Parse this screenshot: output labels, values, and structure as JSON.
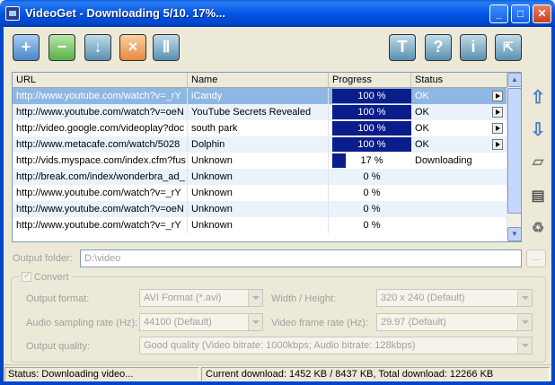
{
  "window": {
    "title": "VideoGet - Downloading 5/10. 17%..."
  },
  "toolbar": {
    "add": "+",
    "remove": "−",
    "download": "↓",
    "stop": "×",
    "pause": "Ⅱ",
    "t": "T",
    "help": "?",
    "info": "i"
  },
  "table": {
    "columns": [
      "URL",
      "Name",
      "Progress",
      "Status"
    ],
    "rows": [
      {
        "url": "http://www.youtube.com/watch?v=_rY",
        "name": "iCandy",
        "progress": 100,
        "progress_text": "100 %",
        "status": "OK"
      },
      {
        "url": "http://www.youtube.com/watch?v=oeN",
        "name": "YouTube Secrets Revealed",
        "progress": 100,
        "progress_text": "100 %",
        "status": "OK"
      },
      {
        "url": "http://video.google.com/videoplay?doc",
        "name": "south park",
        "progress": 100,
        "progress_text": "100 %",
        "status": "OK"
      },
      {
        "url": "http://www.metacafe.com/watch/5028",
        "name": "Dolphin",
        "progress": 100,
        "progress_text": "100 %",
        "status": "OK"
      },
      {
        "url": "http://vids.myspace.com/index.cfm?fus",
        "name": "Unknown",
        "progress": 17,
        "progress_text": "17 %",
        "status": "Downloading"
      },
      {
        "url": "http://break.com/index/wonderbra_ad_",
        "name": "Unknown",
        "progress": 0,
        "progress_text": "0 %",
        "status": ""
      },
      {
        "url": "http://www.youtube.com/watch?v=_rY",
        "name": "Unknown",
        "progress": 0,
        "progress_text": "0 %",
        "status": ""
      },
      {
        "url": "http://www.youtube.com/watch?v=oeN",
        "name": "Unknown",
        "progress": 0,
        "progress_text": "0 %",
        "status": ""
      },
      {
        "url": "http://www.youtube.com/watch?v=_rY",
        "name": "Unknown",
        "progress": 0,
        "progress_text": "0 %",
        "status": ""
      }
    ]
  },
  "output": {
    "label": "Output folder:",
    "value": "D:\\video",
    "browse": "..."
  },
  "convert": {
    "label": "Convert",
    "output_format_label": "Output format:",
    "output_format": "AVI Format (*.avi)",
    "wh_label": "Width / Height:",
    "wh": "320 x 240 (Default)",
    "audio_label": "Audio sampling rate (Hz):",
    "audio": "44100 (Default)",
    "framerate_label": "Video frame rate (Hz):",
    "framerate": "29.97 (Default)",
    "quality_label": "Output quality:",
    "quality": "Good quality   (Video bitrate: 1000kbps; Audio bitrate: 128kbps)"
  },
  "status": {
    "left": "Status: Downloading video...",
    "right": "Current download: 1452 KB / 8437 KB,  Total download: 12266 KB"
  }
}
